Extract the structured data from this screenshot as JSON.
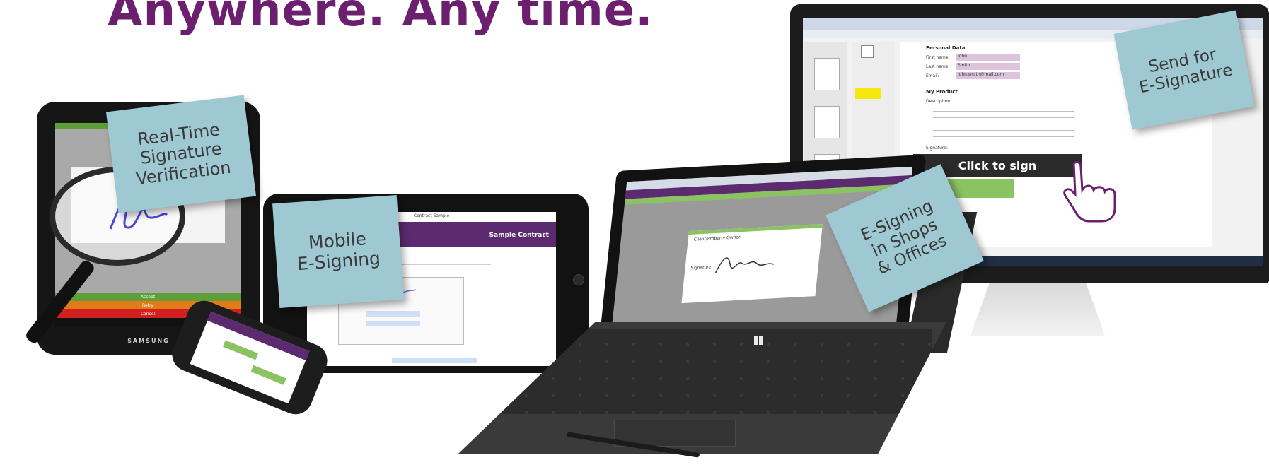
{
  "headline": "Anywhere. Any time.",
  "notes": {
    "verification": [
      "Real-Time",
      "Signature",
      "Verification"
    ],
    "mobile": [
      "Mobile",
      "E-Signing"
    ],
    "shops": [
      "E-Signing",
      "in Shops",
      "& Offices"
    ],
    "send": [
      "Send for",
      "E-Signature"
    ]
  },
  "android_tablet": {
    "brand": "SAMSUNG",
    "bars": [
      {
        "label": "Accept",
        "color": "#5f9f3a"
      },
      {
        "label": "Retry",
        "color": "#e27a1a"
      },
      {
        "label": "Cancel",
        "color": "#d21f1f"
      }
    ]
  },
  "ipad": {
    "contract_title": "Sample Contract",
    "nav_title": "Contract Sample"
  },
  "monitor_form": {
    "section_personal": "Personal Data",
    "first_name_label": "First name:",
    "first_name_value": "John",
    "last_name_label": "Last name:",
    "last_name_value": "Smith",
    "email_label": "Email:",
    "email_value": "john.smith@mail.com",
    "section_product": "My Product",
    "description_label": "Description:",
    "signature_label": "Signature:",
    "click_to_sign": "Click to sign"
  },
  "surface_dialog": {
    "title": "Client/Property Owner",
    "signature_label": "Signature"
  },
  "colors": {
    "headline": "#6b1f6e",
    "note": "#9ec8d2",
    "purple_bar": "#5b2a6f",
    "green": "#8bc363"
  }
}
